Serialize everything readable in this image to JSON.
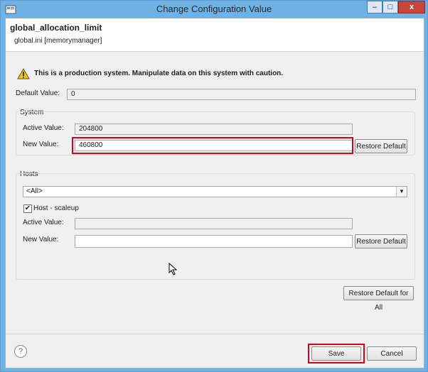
{
  "window": {
    "title": "Change Configuration Value",
    "minimize_label": "–",
    "maximize_label": "□",
    "close_label": "x"
  },
  "parameter": {
    "name": "global_allocation_limit",
    "location": "global.ini [memorymanager]"
  },
  "warning": {
    "text": "This is a production system. Manipulate data on this system with caution.",
    "icon": "warning-icon"
  },
  "default_value": {
    "label": "Default Value:",
    "value": "0"
  },
  "system": {
    "title": "System",
    "active_label": "Active Value:",
    "active_value": "204800",
    "new_label": "New Value:",
    "new_value": "460800",
    "restore_label": "Restore Default"
  },
  "hosts": {
    "title": "Hosts",
    "selected": "<All>",
    "host_label": "Host - scaleup",
    "host_checked": true,
    "active_label": "Active Value:",
    "active_value": "",
    "new_label": "New Value:",
    "new_value": "",
    "restore_label": "Restore Default"
  },
  "restore_all_label": "Restore Default for All",
  "footer": {
    "help_label": "?",
    "save_label": "Save",
    "cancel_label": "Cancel"
  },
  "colors": {
    "highlight": "#d6001c",
    "titlebar": "#6fb2e3"
  }
}
